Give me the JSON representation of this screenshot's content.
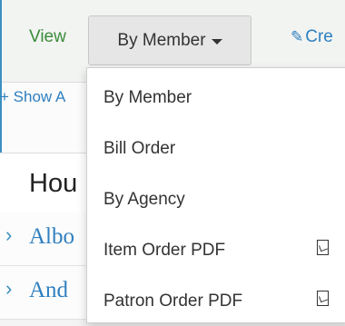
{
  "toolbar": {
    "view_label": "View",
    "view_select_value": "By Member",
    "create_label": "Cre"
  },
  "content": {
    "show_all_label": "+ Show A",
    "heading": "Hou",
    "rows": [
      "Albo",
      "And"
    ]
  },
  "dropdown": {
    "items": [
      {
        "label": "By Member",
        "icon": ""
      },
      {
        "label": "Bill Order",
        "icon": ""
      },
      {
        "label": "By Agency",
        "icon": ""
      },
      {
        "label": "Item Order PDF",
        "icon": "pdf-icon"
      },
      {
        "label": "Patron Order PDF",
        "icon": "pdf-icon"
      }
    ]
  }
}
